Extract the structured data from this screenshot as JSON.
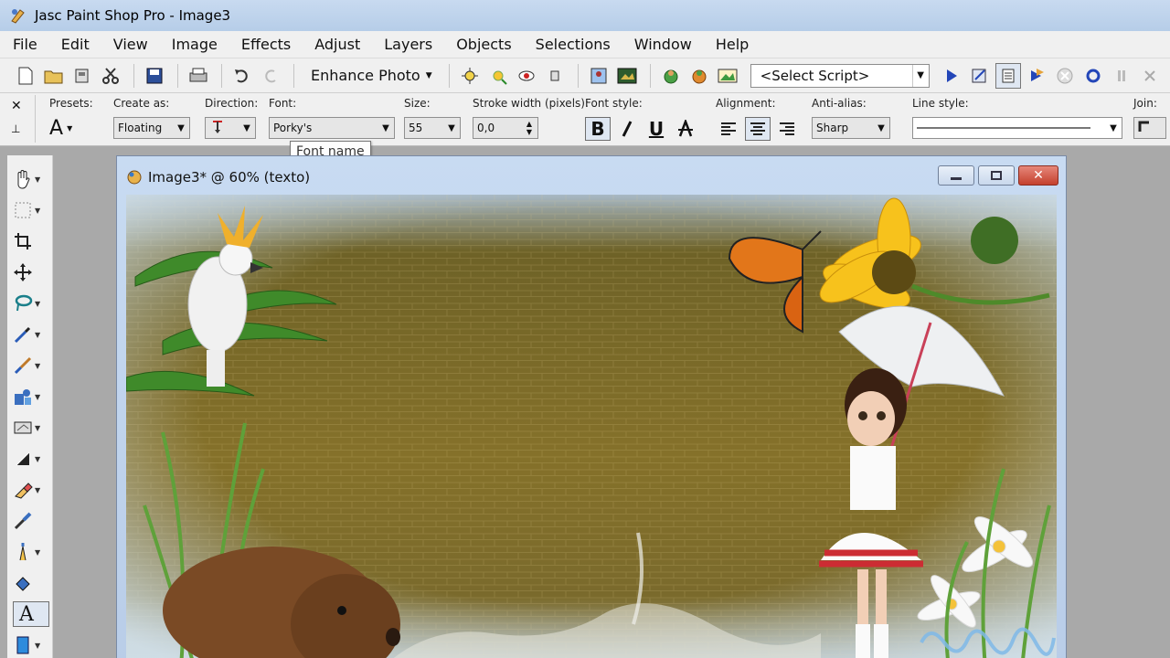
{
  "app": {
    "title": "Jasc Paint Shop Pro - Image3"
  },
  "menu": [
    "File",
    "Edit",
    "View",
    "Image",
    "Effects",
    "Adjust",
    "Layers",
    "Objects",
    "Selections",
    "Window",
    "Help"
  ],
  "toolbar": {
    "enhance_label": "Enhance Photo",
    "script_select": "<Select Script>"
  },
  "options": {
    "presets_label": "Presets:",
    "create_as_label": "Create as:",
    "create_as_value": "Floating",
    "direction_label": "Direction:",
    "font_label": "Font:",
    "font_value": "Porky's",
    "size_label": "Size:",
    "size_value": "55",
    "stroke_label": "Stroke width (pixels):",
    "stroke_value": "0,0",
    "font_style_label": "Font style:",
    "font_style_bold": "B",
    "font_style_underline": "U",
    "alignment_label": "Alignment:",
    "antialias_label": "Anti-alias:",
    "antialias_value": "Sharp",
    "line_style_label": "Line style:",
    "join_label": "Join:"
  },
  "tooltip": {
    "text": "Font name"
  },
  "document": {
    "title": "Image3* @  60% (texto)"
  },
  "colors": {
    "titlebar": "#c2d6ee",
    "chrome": "#f0f0f0",
    "canvas_brown": "#7a6720",
    "frame_blue": "#b9cde8",
    "close_red": "#c94a35"
  }
}
